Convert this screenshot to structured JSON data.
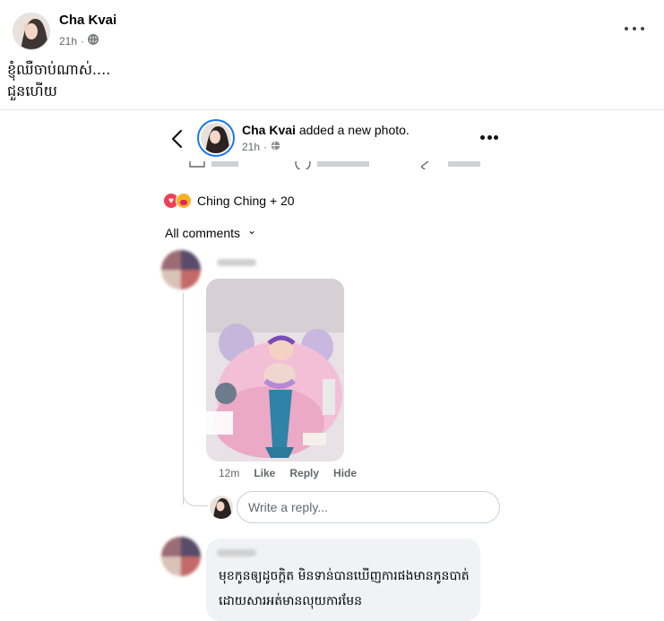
{
  "post": {
    "author": "Cha Kvai",
    "time": "21h",
    "separator": "·",
    "caption_line1": "ខ្ញុំឈឺចាប់ណាស់....",
    "caption_line2": " ជួនហើយ"
  },
  "shared_screenshot": {
    "author": "Cha Kvai",
    "action": "added a new photo.",
    "time": "21h",
    "separator": "·",
    "reactions_text": "Ching Ching + 20",
    "all_comments_label": "All comments",
    "all_comments_chevron": "⌄",
    "comment1": {
      "time": "12m",
      "like_label": "Like",
      "reply_label": "Reply",
      "hide_label": "Hide"
    },
    "reply_placeholder": "Write a reply...",
    "comment2": {
      "text_line1": "មុខកូនឲ្យដូចក្តិត មិនទាន់បានឃើញការផងមានកូនបាត់",
      "text_line2": "ដោយសារអត់មានលុយការមែន"
    }
  },
  "icons": {
    "globe": "globe-icon",
    "more": "more-horizontal-icon",
    "back": "chevron-left-icon",
    "heart": "heart-reaction-icon",
    "care": "care-reaction-icon"
  },
  "colors": {
    "accent": "#1877f2",
    "text": "#050505",
    "secondary": "#65676b",
    "bubble": "#f0f2f5",
    "heart": "#f33e58"
  }
}
